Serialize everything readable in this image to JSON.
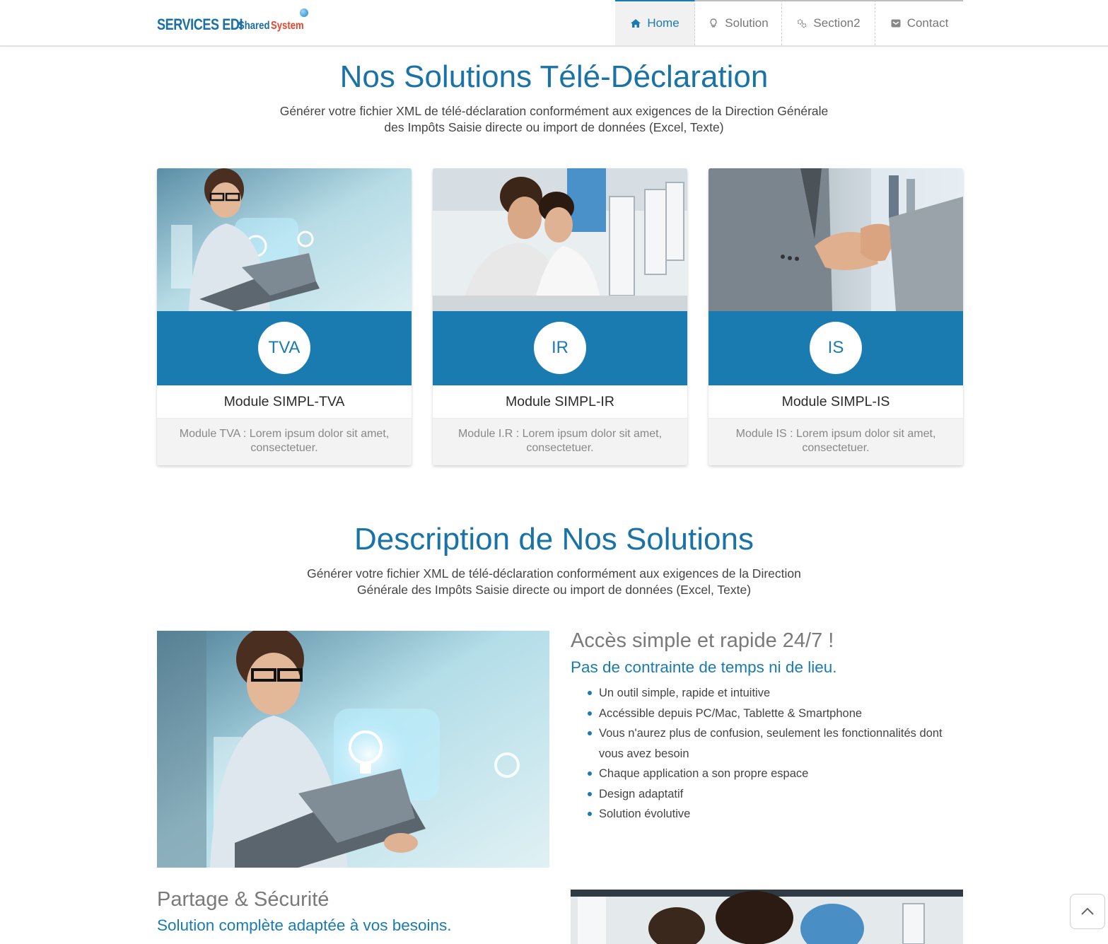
{
  "brand": {
    "main": "SERVICES EDI",
    "shared": "Shared",
    "system": "System"
  },
  "nav": [
    {
      "label": "Home",
      "icon": "home-icon",
      "active": true
    },
    {
      "label": "Solution",
      "icon": "lightbulb-icon",
      "active": false
    },
    {
      "label": "Section2",
      "icon": "cogs-icon",
      "active": false
    },
    {
      "label": "Contact",
      "icon": "envelope-icon",
      "active": false
    }
  ],
  "section1": {
    "title": "Nos Solutions Télé-Déclaration",
    "subtitle_line1": "Générer votre fichier XML de télé-déclaration conformément aux exigences de la Direction Générale",
    "subtitle_line2": "des Impôts Saisie directe ou import de données (Excel, Texte)"
  },
  "cards": [
    {
      "badge": "TVA",
      "title": "Module SIMPL-TVA",
      "desc_line1": "Module TVA : Lorem ipsum dolor sit amet,",
      "desc_line2": "consectetuer."
    },
    {
      "badge": "IR",
      "title": "Module SIMPL-IR",
      "desc_line1": "Module I.R : Lorem ipsum dolor sit amet,",
      "desc_line2": "consectetuer."
    },
    {
      "badge": "IS",
      "title": "Module SIMPL-IS",
      "desc_line1": "Module IS : Lorem ipsum dolor sit amet,",
      "desc_line2": "consectetuer."
    }
  ],
  "section2": {
    "title": "Description de Nos Solutions",
    "subtitle_line1": "Générer votre fichier XML de télé-déclaration conformément aux exigences de la Direction",
    "subtitle_line2": "Générale des Impôts Saisie directe ou import de données (Excel, Texte)"
  },
  "feature1": {
    "heading": "Accès simple et rapide 24/7 !",
    "subheading": "Pas de contrainte de temps ni de lieu.",
    "items": [
      "Un outil simple, rapide et intuitive",
      "Accéssible depuis PC/Mac, Tablette & Smartphone",
      "Vous n'aurez plus de confusion, seulement les fonctionnalités dont vous avez besoin",
      "Chaque application a son propre espace",
      "Design adaptatif",
      "Solution évolutive"
    ]
  },
  "feature2": {
    "heading": "Partage & Sécurité",
    "subheading": "Solution complète adaptée à vos besoins."
  },
  "colors": {
    "accent": "#1a7bb0",
    "title": "#1a73a7",
    "logo_red": "#e8452c"
  },
  "scroll_top_icon": "chevron-up-icon"
}
